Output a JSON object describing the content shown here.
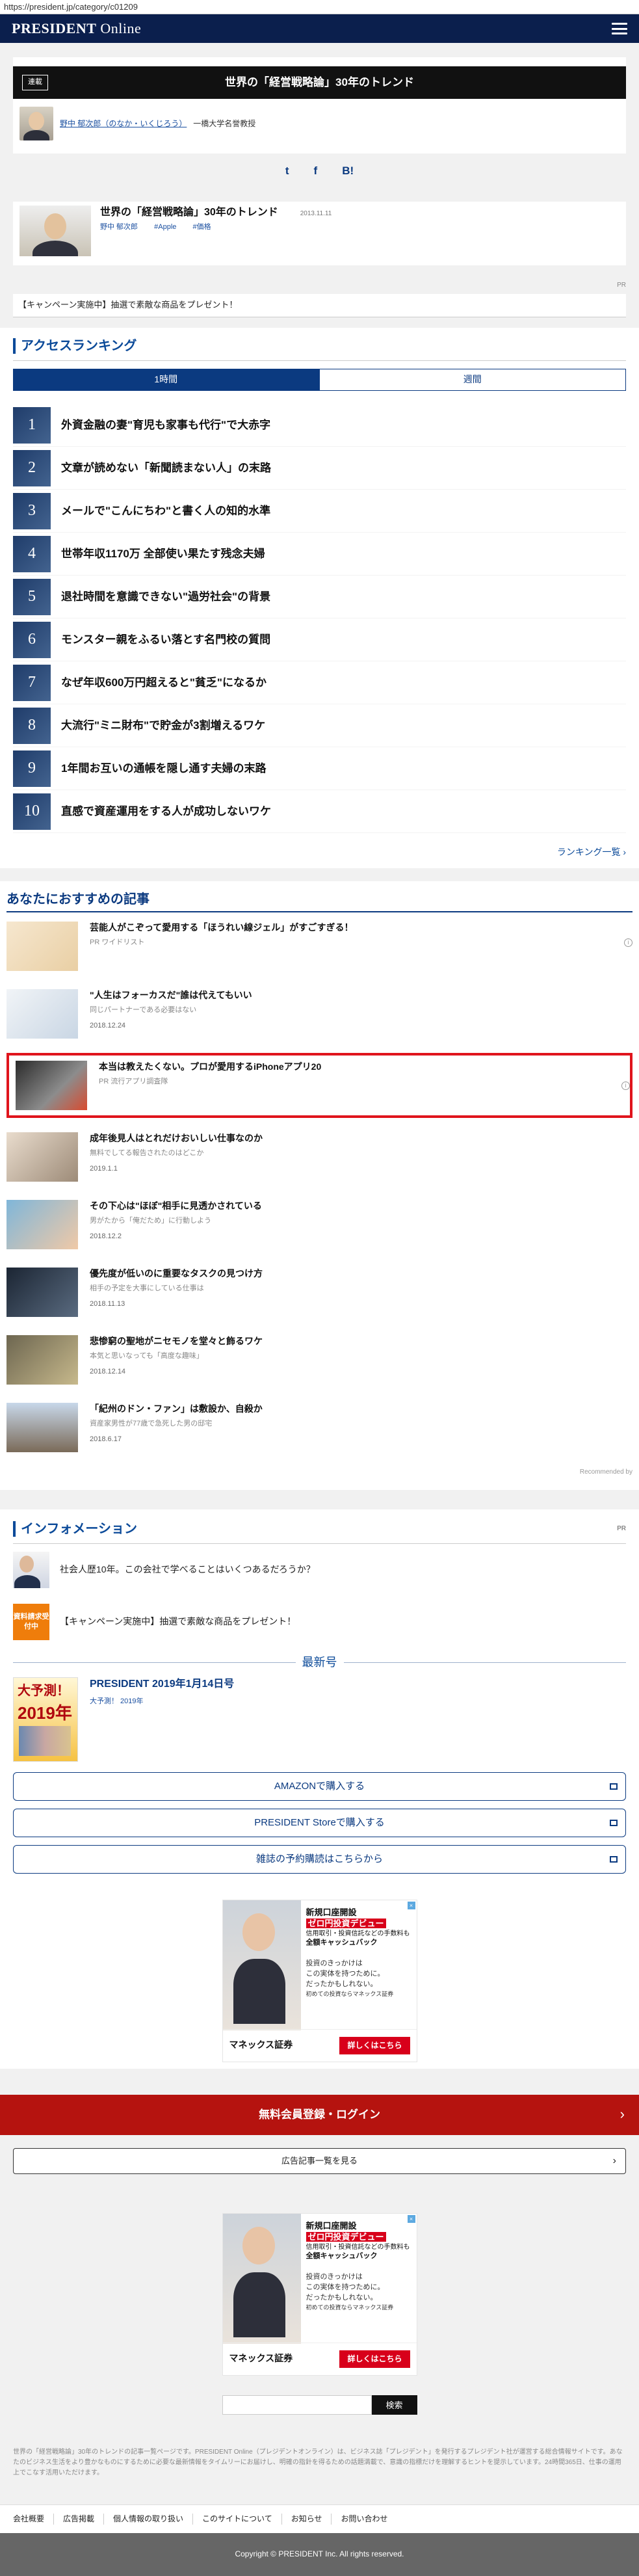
{
  "browser": {
    "url": "https://president.jp/category/c01209"
  },
  "header": {
    "logo_main": "PRESIDENT",
    "logo_sub": "Online"
  },
  "series": {
    "badge": "連載",
    "title": "世界の「経営戦略論」30年のトレンド",
    "author_name": "野中 郁次郎（のなか・いくじろう）",
    "author_role": "一橋大学名誉教授",
    "share": {
      "twitter": "t",
      "facebook": "f",
      "hatena": "B!"
    }
  },
  "article": {
    "title": "世界の「経営戦略論」30年のトレンド",
    "date": "2013.11.11",
    "tags": [
      "野中 郁次郎",
      "#Apple",
      "#価格"
    ]
  },
  "pr": {
    "label": "PR",
    "text": "【キャンペーン実施中】抽選で素敵な商品をプレゼント！"
  },
  "ranking": {
    "heading": "アクセスランキング",
    "tabs": [
      "1時間",
      "週間"
    ],
    "items": [
      {
        "num": "1",
        "title": "外資金融の妻\"育児も家事も代行\"で大赤字"
      },
      {
        "num": "2",
        "title": "文章が読めない「新聞読まない人」の末路"
      },
      {
        "num": "3",
        "title": "メールで\"こんにちわ\"と書く人の知的水準"
      },
      {
        "num": "4",
        "title": "世帯年収1170万 全部使い果たす残念夫婦"
      },
      {
        "num": "5",
        "title": "退社時間を意識できない\"過労社会\"の背景"
      },
      {
        "num": "6",
        "title": "モンスター親をふるい落とす名門校の質問"
      },
      {
        "num": "7",
        "title": "なぜ年収600万円超えると\"貧乏\"になるか"
      },
      {
        "num": "8",
        "title": "大流行\"ミニ財布\"で貯金が3割増えるワケ"
      },
      {
        "num": "9",
        "title": "1年間お互いの通帳を隠し通す夫婦の末路"
      },
      {
        "num": "10",
        "title": "直感で資産運用をする人が成功しないワケ"
      }
    ],
    "more": "ランキング一覧 ›"
  },
  "recommend": {
    "heading": "あなたにおすすめの記事",
    "items": [
      {
        "title": "芸能人がこぞって愛用する「ほうれい線ジェル」がすごすぎる！",
        "sub": "PR ワイドリスト",
        "date": "",
        "sponsored": true
      },
      {
        "title": "\"人生はフォーカスだ\"誰は代えてもいい",
        "sub": "同じパートナーである必要はない",
        "date": "2018.12.24",
        "sponsored": false
      },
      {
        "title": "本当は教えたくない。プロが愛用するiPhoneアプリ20",
        "sub": "PR 流行アプリ調査隊",
        "date": "",
        "sponsored": true
      },
      {
        "title": "成年後見人はとれだけおいしい仕事なのか",
        "sub": "無料でしてる報告されたのはどこか",
        "date": "2019.1.1",
        "sponsored": false
      },
      {
        "title": "その下心は\"ほぼ\"相手に見透かされている",
        "sub": "男がたから「俺だため」に行動しよう",
        "date": "2018.12.2",
        "sponsored": false
      },
      {
        "title": "優先度が低いのに重要なタスクの見つけ方",
        "sub": "相手の予定を大事にしている仕事は",
        "date": "2018.11.13",
        "sponsored": false
      },
      {
        "title": "悲惨窮の聖地がニセモノを堂々と飾るワケ",
        "sub": "本気と思いなっても「高度な趣味」",
        "date": "2018.12.14",
        "sponsored": false
      },
      {
        "title": "「紀州のドン・ファン」は敷設か、自殺か",
        "sub": "資産家男性が77歳で急死した男の邸宅",
        "date": "2018.6.17",
        "sponsored": false
      }
    ],
    "recommended_by": "Recommended by"
  },
  "info": {
    "heading": "インフォメーション",
    "pr_label": "PR",
    "rows": [
      {
        "text": "社会人歴10年。この会社で学べることはいくつあるだろうか？"
      },
      {
        "badge": "資料請求受付中",
        "text": "【キャンペーン実施中】抽選で素敵な商品をプレゼント！"
      }
    ],
    "latest_heading": "最新号",
    "issue_title": "PRESIDENT 2019年1月14日号",
    "issue_sub": "大予測！ 2019年",
    "cover_line1": "大予測！",
    "cover_line2": "2019年",
    "buy_buttons": [
      "AMAZONで購入する",
      "PRESIDENT Storeで購入する",
      "雑誌の予約購読はこちらから"
    ]
  },
  "ad": {
    "head_line1": "新規口座開設",
    "head_line2": "ゼロ円投資デビュー",
    "head_line3": "信用取引・投資信託などの手数料も",
    "head_line4": "全額キャッシュバック",
    "body_line1": "投資のきっかけは",
    "body_line2": "この実体を持つために。",
    "body_line3": "だったかもしれない。",
    "body_line4": "初めての投資ならマネックス証券",
    "brand": "マネックス証券",
    "cta": "詳しくはこちら"
  },
  "register": {
    "label": "無料会員登録・ログイン",
    "chevron": "›"
  },
  "adlist": {
    "label": "広告記事一覧を見る",
    "chevron": "›"
  },
  "search": {
    "placeholder": "",
    "button": "検索"
  },
  "footer": {
    "description": "世界の「経営戦略論」30年のトレンドの記事一覧ページです。PRESIDENT Online（プレジデントオンライン）は、ビジネス誌「プレジデント」を発行するプレジデント社が運営する総合情報サイトです。あなたのビジネス生活をより豊かなものにするために必要な最新情報をタイムリーにお届けし、明確の指針を得るための話題満載で、意識の指標だけを理解するヒントを提示しています。24時間365日、仕事の運用上でこなす活用いただけます。",
    "nav": [
      "会社概要",
      "広告掲載",
      "個人情報の取り扱い",
      "このサイトについて",
      "お知らせ",
      "お問い合わせ"
    ],
    "copyright": "Copyright © PRESIDENT Inc. All rights reserved."
  }
}
